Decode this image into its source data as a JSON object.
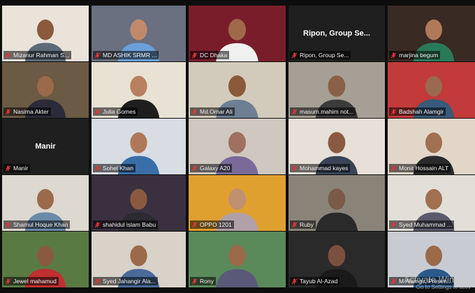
{
  "participants": [
    {
      "name": "Mizanur Rahman S...",
      "mode": "video",
      "colors": {
        "bg": "#e9e3da",
        "body": "#5c6a7a",
        "skin": "#8b5a3c"
      }
    },
    {
      "name": "MD ASHIK SRMR ...",
      "mode": "video",
      "colors": {
        "bg": "#6a7080",
        "body": "#6aa0d8",
        "skin": "#c08a6a"
      }
    },
    {
      "name": "DC Dhaka",
      "mode": "video",
      "active": true,
      "colors": {
        "bg": "#7a1d2a",
        "body": "#f0f0f0",
        "skin": "#a06a4a"
      }
    },
    {
      "name": "Ripon, Group Se...",
      "mode": "name_only"
    },
    {
      "name": "marjina begum",
      "mode": "video",
      "colors": {
        "bg": "#3a2a24",
        "body": "#2a7a5a",
        "skin": "#b07a5a"
      }
    },
    {
      "name": "Nasima Akter",
      "mode": "video",
      "colors": {
        "bg": "#6b5a44",
        "body": "#2b2b3a",
        "skin": "#9a6a4a"
      }
    },
    {
      "name": "Julia Gomes",
      "mode": "video",
      "colors": {
        "bg": "#e8e2d4",
        "body": "#1e1e1e",
        "skin": "#b88060"
      }
    },
    {
      "name": "Md.Omar Ali",
      "mode": "video",
      "colors": {
        "bg": "#d2cbbb",
        "body": "#6d7f93",
        "skin": "#8a5a3a"
      }
    },
    {
      "name": "masum.mahim not...",
      "mode": "video",
      "colors": {
        "bg": "#a59f95",
        "body": "#3b3b3b",
        "skin": "#8a6048"
      }
    },
    {
      "name": "Badshah Alamgir",
      "mode": "video",
      "colors": {
        "bg": "#c23a3a",
        "body": "#3a5a7a",
        "skin": "#9a6a50"
      }
    },
    {
      "name": "Manir",
      "mode": "name_only"
    },
    {
      "name": "Sohel Khan",
      "mode": "video",
      "colors": {
        "bg": "#d8dde4",
        "body": "#3a6ea8",
        "skin": "#b0785a"
      }
    },
    {
      "name": "Galaxy A20",
      "mode": "video",
      "colors": {
        "bg": "#cfc8c0",
        "body": "#7a6a9a",
        "skin": "#a07060"
      }
    },
    {
      "name": "Mohammad kayes",
      "mode": "video",
      "colors": {
        "bg": "#e6e0d8",
        "body": "#3a4458",
        "skin": "#8a5a40"
      }
    },
    {
      "name": "Monir Hossain ALT",
      "mode": "video",
      "colors": {
        "bg": "#e2d6c8",
        "body": "#2a2a2a",
        "skin": "#a07050"
      }
    },
    {
      "name": "Shamul Hoque Khan",
      "mode": "video",
      "colors": {
        "bg": "#ddd8d0",
        "body": "#6a8aa8",
        "skin": "#9a6a4a"
      }
    },
    {
      "name": "shahidul islam Babu",
      "mode": "video",
      "colors": {
        "bg": "#3a3040",
        "body": "#2a2a30",
        "skin": "#8a5a40"
      }
    },
    {
      "name": "OPPO 1201",
      "mode": "video",
      "colors": {
        "bg": "#e0a030",
        "body": "#b0a0a8",
        "skin": "#c09070"
      }
    },
    {
      "name": "Ruby",
      "mode": "video",
      "colors": {
        "bg": "#8a8478",
        "body": "#2a2a2a",
        "skin": "#7a5a48"
      }
    },
    {
      "name": "Syed Muhammad ...",
      "mode": "video",
      "colors": {
        "bg": "#e2ded8",
        "body": "#5a5a6a",
        "skin": "#a07050"
      }
    },
    {
      "name": "Jewel mahamud",
      "mode": "video",
      "colors": {
        "bg": "#5a7a44",
        "body": "#c03030",
        "skin": "#8a5a40"
      }
    },
    {
      "name": "Syed Jahangir Ala...",
      "mode": "video",
      "colors": {
        "bg": "#d8d2c8",
        "body": "#4a6a9a",
        "skin": "#9a6a4a"
      }
    },
    {
      "name": "Rony",
      "mode": "video",
      "colors": {
        "bg": "#5a8a5a",
        "body": "#5a5a78",
        "skin": "#9a6a4a"
      }
    },
    {
      "name": "Tayub Al-Azad",
      "mode": "video",
      "colors": {
        "bg": "#2a2a2a",
        "body": "#1a1a1a",
        "skin": "#7a5040"
      }
    },
    {
      "name": "M Alamgir, Presen...",
      "mode": "video",
      "colors": {
        "bg": "#c8ccd2",
        "body": "#2a5a8a",
        "skin": "#9a6a4a"
      }
    }
  ],
  "watermark": {
    "line1": "Activate Window",
    "line2": "Go to Settings to activ"
  },
  "mic_muted_color": "#e0363c"
}
